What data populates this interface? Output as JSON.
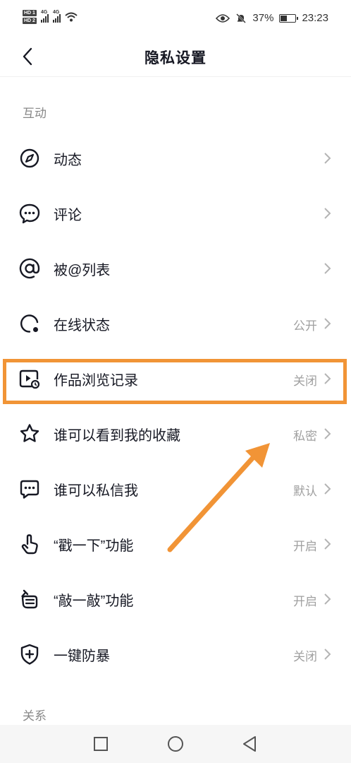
{
  "status_bar": {
    "sim1": "HD 1",
    "sim2": "HD 2",
    "network1": "4G",
    "network2": "4G",
    "battery_percent": "37%",
    "battery_level": 0.37,
    "time": "23:23"
  },
  "header": {
    "title": "隐私设置"
  },
  "sections": {
    "interaction": "互动",
    "relation": "关系"
  },
  "items": [
    {
      "label": "动态",
      "value": ""
    },
    {
      "label": "评论",
      "value": ""
    },
    {
      "label": "被@列表",
      "value": ""
    },
    {
      "label": "在线状态",
      "value": "公开"
    },
    {
      "label": "作品浏览记录",
      "value": "关闭"
    },
    {
      "label": "谁可以看到我的收藏",
      "value": "私密"
    },
    {
      "label": "谁可以私信我",
      "value": "默认"
    },
    {
      "label": "“戳一下”功能",
      "value": "开启"
    },
    {
      "label": "“敲一敲”功能",
      "value": "开启"
    },
    {
      "label": "一键防暴",
      "value": "关闭"
    }
  ],
  "annotation_color": "#f19436"
}
